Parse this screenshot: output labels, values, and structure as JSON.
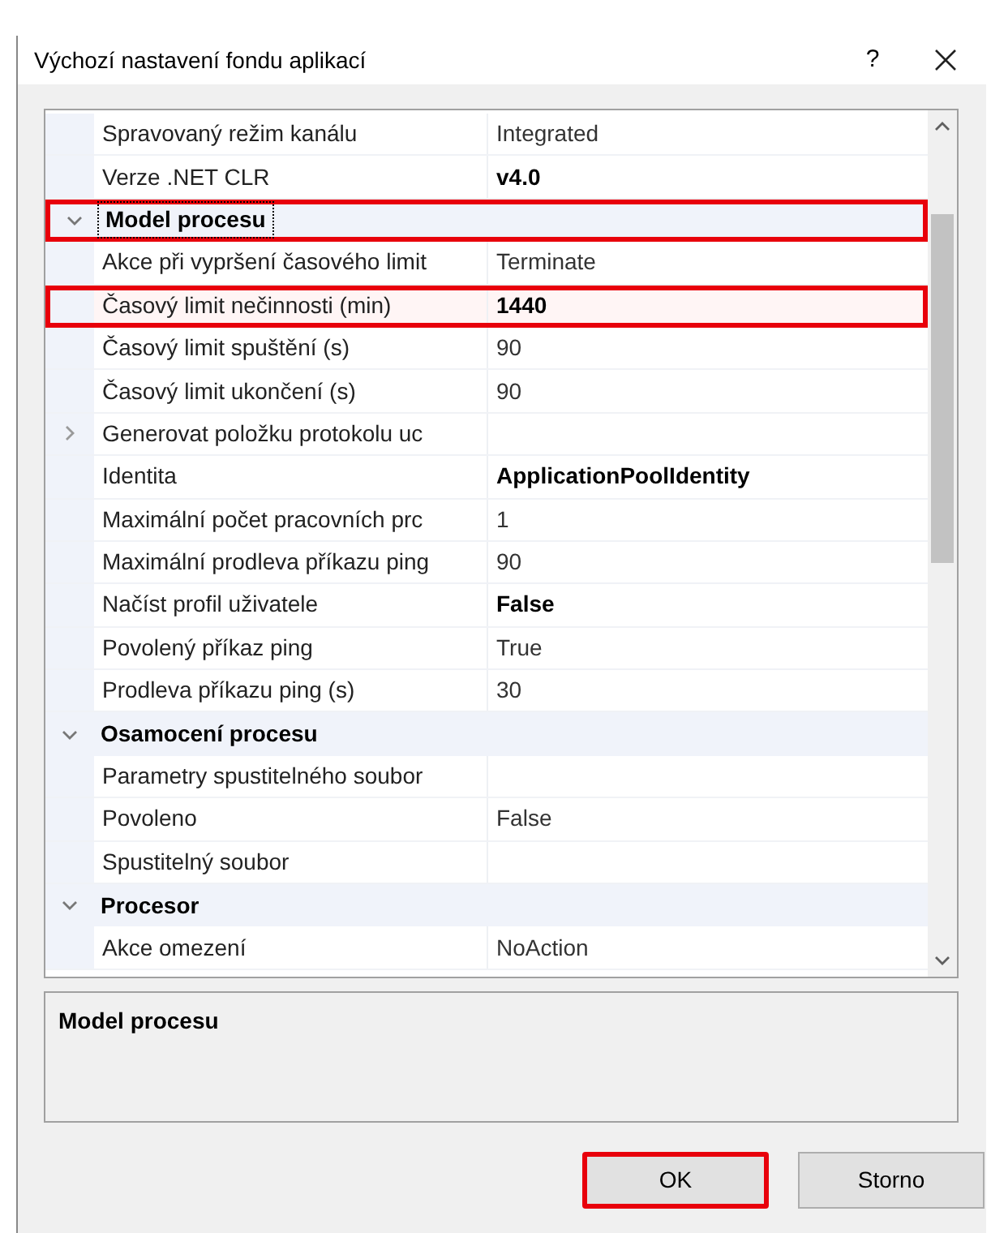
{
  "window": {
    "title": "Výchozí nastavení fondu aplikací",
    "help": "?"
  },
  "grid": {
    "rows": [
      {
        "kind": "property",
        "name": "Spravovaný režim kanálu",
        "value": "Integrated",
        "bold": false,
        "highlighted": false
      },
      {
        "kind": "property",
        "name": "Verze .NET CLR",
        "value": "v4.0",
        "bold": true,
        "highlighted": false
      },
      {
        "kind": "category",
        "name": "Model procesu",
        "expanded": true,
        "selected": true,
        "highlighted": true
      },
      {
        "kind": "property",
        "name": "Akce při vypršení časového limit",
        "value": "Terminate",
        "bold": false,
        "highlighted": false
      },
      {
        "kind": "property",
        "name": "Časový limit nečinnosti (min)",
        "value": "1440",
        "bold": true,
        "highlighted": true
      },
      {
        "kind": "property",
        "name": "Časový limit spuštění (s)",
        "value": "90",
        "bold": false,
        "highlighted": false
      },
      {
        "kind": "property",
        "name": "Časový limit ukončení (s)",
        "value": "90",
        "bold": false,
        "highlighted": false
      },
      {
        "kind": "expandable",
        "name": "Generovat položku protokolu uc",
        "expanded": false,
        "highlighted": false
      },
      {
        "kind": "property",
        "name": "Identita",
        "value": "ApplicationPoolIdentity",
        "bold": true,
        "highlighted": false
      },
      {
        "kind": "property",
        "name": "Maximální počet pracovních prc",
        "value": "1",
        "bold": false,
        "highlighted": false
      },
      {
        "kind": "property",
        "name": "Maximální prodleva příkazu ping",
        "value": "90",
        "bold": false,
        "highlighted": false
      },
      {
        "kind": "property",
        "name": "Načíst profil uživatele",
        "value": "False",
        "bold": true,
        "highlighted": false
      },
      {
        "kind": "property",
        "name": "Povolený příkaz ping",
        "value": "True",
        "bold": false,
        "highlighted": false
      },
      {
        "kind": "property",
        "name": "Prodleva příkazu ping (s)",
        "value": "30",
        "bold": false,
        "highlighted": false
      },
      {
        "kind": "category",
        "name": "Osamocení procesu",
        "expanded": true,
        "selected": false,
        "highlighted": false
      },
      {
        "kind": "property",
        "name": "Parametry spustitelného soubor",
        "highlighted": false
      },
      {
        "kind": "property",
        "name": "Povoleno",
        "value": "False",
        "bold": false,
        "highlighted": false
      },
      {
        "kind": "property",
        "name": "Spustitelný soubor",
        "highlighted": false
      },
      {
        "kind": "category",
        "name": "Procesor",
        "expanded": true,
        "selected": false,
        "highlighted": false
      },
      {
        "kind": "property",
        "name": "Akce omezení",
        "value": "NoAction",
        "bold": false,
        "highlighted": false
      }
    ]
  },
  "description": {
    "title": "Model procesu"
  },
  "buttons": [
    {
      "label": "OK",
      "highlighted": true
    },
    {
      "label": "Storno",
      "highlighted": false
    }
  ]
}
